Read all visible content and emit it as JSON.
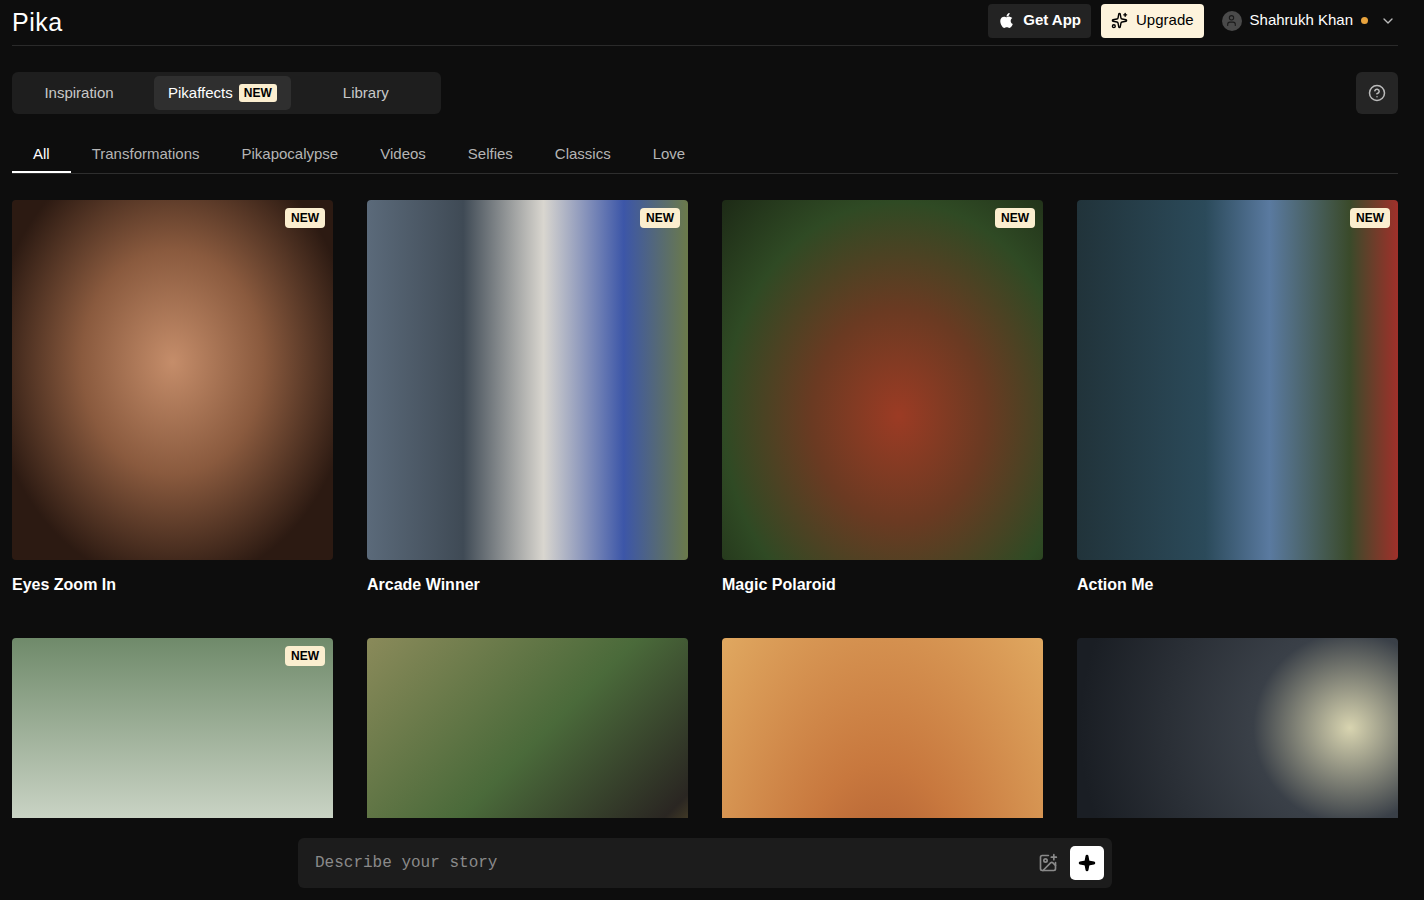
{
  "app": {
    "logo": "Pika"
  },
  "header": {
    "get_app": "Get App",
    "upgrade": "Upgrade",
    "user": {
      "name": "Shahrukh Khan"
    }
  },
  "main_tabs": [
    {
      "label": "Inspiration",
      "selected": false
    },
    {
      "label": "Pikaffects",
      "selected": true,
      "badge": "NEW"
    },
    {
      "label": "Library",
      "selected": false
    }
  ],
  "categories": [
    {
      "label": "All",
      "selected": true
    },
    {
      "label": "Transformations",
      "selected": false
    },
    {
      "label": "Pikapocalypse",
      "selected": false
    },
    {
      "label": "Videos",
      "selected": false
    },
    {
      "label": "Selfies",
      "selected": false
    },
    {
      "label": "Classics",
      "selected": false
    },
    {
      "label": "Love",
      "selected": false
    }
  ],
  "cards": [
    {
      "title": "Eyes Zoom In",
      "badge": "NEW"
    },
    {
      "title": "Arcade Winner",
      "badge": "NEW"
    },
    {
      "title": "Magic Polaroid",
      "badge": "NEW"
    },
    {
      "title": "Action Me",
      "badge": "NEW"
    },
    {
      "badge": "NEW"
    },
    {},
    {},
    {}
  ],
  "prompt": {
    "placeholder": "Describe your story"
  }
}
